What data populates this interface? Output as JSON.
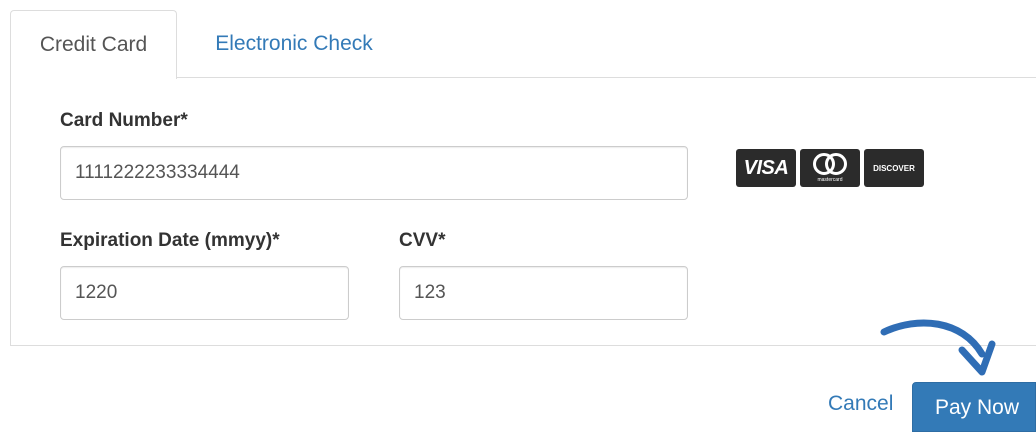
{
  "tabs": [
    {
      "label": "Credit Card",
      "active": true
    },
    {
      "label": "Electronic Check",
      "active": false
    }
  ],
  "form": {
    "card_number": {
      "label": "Card Number*",
      "value": "1111222233334444"
    },
    "expiration": {
      "label": "Expiration Date (mmyy)*",
      "value": "1220"
    },
    "cvv": {
      "label": "CVV*",
      "value": "123"
    }
  },
  "card_logos": {
    "visa": "VISA",
    "mastercard": "mastercard",
    "discover": "DISCOVER"
  },
  "actions": {
    "cancel_label": "Cancel",
    "pay_label": "Pay Now"
  },
  "icons": {
    "arrow": "curved-arrow-icon"
  },
  "colors": {
    "link": "#337ab7",
    "primary_button": "#337ab7",
    "arrow": "#2f6db5"
  }
}
